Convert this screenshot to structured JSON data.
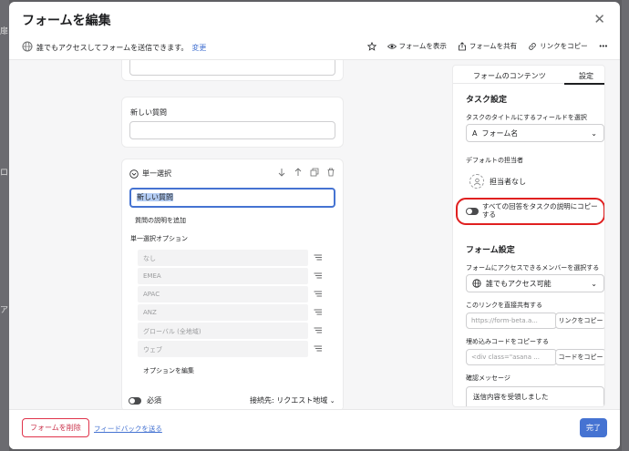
{
  "background": {
    "glyphs": [
      "扉",
      "ロ",
      "ア"
    ]
  },
  "modal": {
    "title": "フォームを編集",
    "close_glyph": "✕"
  },
  "subbar": {
    "access_text": "誰でもアクセスしてフォームを送信できます。",
    "change_link": "変更",
    "view_form": "フォームを表示",
    "share_form": "フォームを共有",
    "copy_link": "リンクをコピー",
    "more": "•••"
  },
  "form": {
    "new_question_label": "新しい質問",
    "question": {
      "type_label": "単一選択",
      "title_value": "新しい質問",
      "add_description": "質問の説明を追加",
      "options_label": "単一選択オプション",
      "options": [
        "なし",
        "EMEA",
        "APAC",
        "ANZ",
        "グローバル (全地域)",
        "ウェブ"
      ],
      "edit_options": "オプションを編集",
      "required_label": "必須",
      "connect_label": "接続先: リクエスト地域"
    }
  },
  "settings": {
    "tabs": [
      "フォームのコンテンツ",
      "設定"
    ],
    "active_tab": "設定",
    "task_settings_heading": "タスク設定",
    "task_title_field_label": "タスクのタイトルにするフィールドを選択",
    "task_title_field_value": "フォーム名",
    "default_assignee_label": "デフォルトの担当者",
    "default_assignee_value": "担当者なし",
    "copy_answers_text": "すべての回答をタスクの説明にコピーする",
    "form_settings_heading": "フォーム設定",
    "access_member_label": "フォームにアクセスできるメンバーを選択する",
    "access_member_value": "誰でもアクセス可能",
    "share_link_label": "このリンクを直接共有する",
    "share_link_value": "https://form-beta.a...",
    "copy_link_button": "リンクをコピー",
    "embed_label": "埋め込みコードをコピーする",
    "embed_value": "<div class=\"asana ...",
    "copy_code_button": "コードをコピー",
    "confirm_label": "確認メッセージ",
    "confirm_value": "送信内容を受領しました"
  },
  "footer": {
    "delete_button": "フォームを削除",
    "feedback_link": "フィードバックを送る",
    "done_button": "完了"
  },
  "colors": {
    "accent": "#4573d2",
    "danger": "#c92f48",
    "highlight_ring": "#e02020"
  }
}
